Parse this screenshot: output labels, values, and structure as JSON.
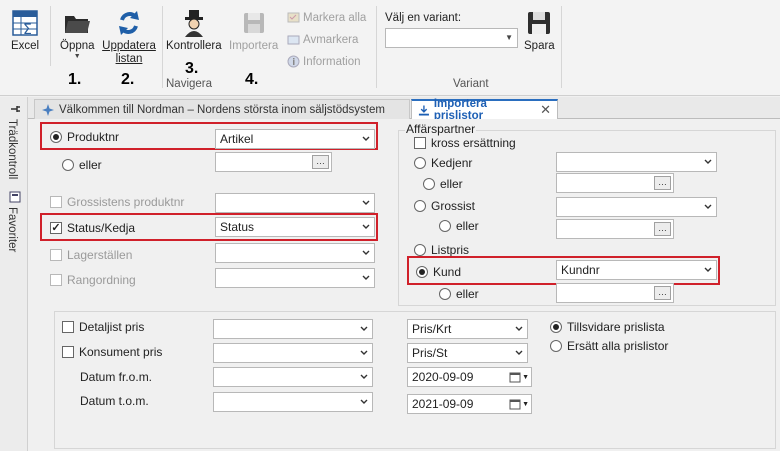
{
  "ribbon": {
    "excel": "Excel",
    "open": "Öppna",
    "refresh": "Uppdatera listan",
    "control": "Kontrollera",
    "import": "Importera",
    "navigate_group": "Navigera",
    "mark_all": "Markera alla",
    "unmark": "Avmarkera",
    "information": "Information",
    "choose_variant": "Välj en variant:",
    "variant_value": "",
    "save": "Spara",
    "variant_group": "Variant",
    "steps": [
      "1.",
      "2.",
      "3.",
      "4."
    ]
  },
  "sidebar": {
    "tree": "Trädkontroll",
    "favorites": "Favoriter"
  },
  "tabs": [
    {
      "label": "Välkommen till Nordman – Nordens största inom säljstödsystem"
    },
    {
      "label": "Importera prislistor"
    }
  ],
  "form": {
    "produktnr": "Produktnr",
    "artikel": "Artikel",
    "eller": "eller",
    "grossistens_produktnr": "Grossistens produktnr",
    "status_kedja": "Status/Kedja",
    "status": "Status",
    "lagerstallen": "Lagerställen",
    "rangordning": "Rangordning",
    "affarspartner": "Affärspartner",
    "kross": "kross ersättning",
    "kedjenr": "Kedjenr",
    "grossist": "Grossist",
    "listpris": "Listpris",
    "kund": "Kund",
    "kundnr": "Kundnr",
    "detaljist_pris": "Detaljist pris",
    "konsument_pris": "Konsument pris",
    "datum_from": "Datum fr.o.m.",
    "datum_tom": "Datum t.o.m.",
    "pris_krt": "Pris/Krt",
    "pris_st": "Pris/St",
    "date_from": "2020-09-09",
    "date_to": "2021-09-09",
    "tillsvidare": "Tillsvidare prislista",
    "ersatt": "Ersätt alla prislistor"
  }
}
